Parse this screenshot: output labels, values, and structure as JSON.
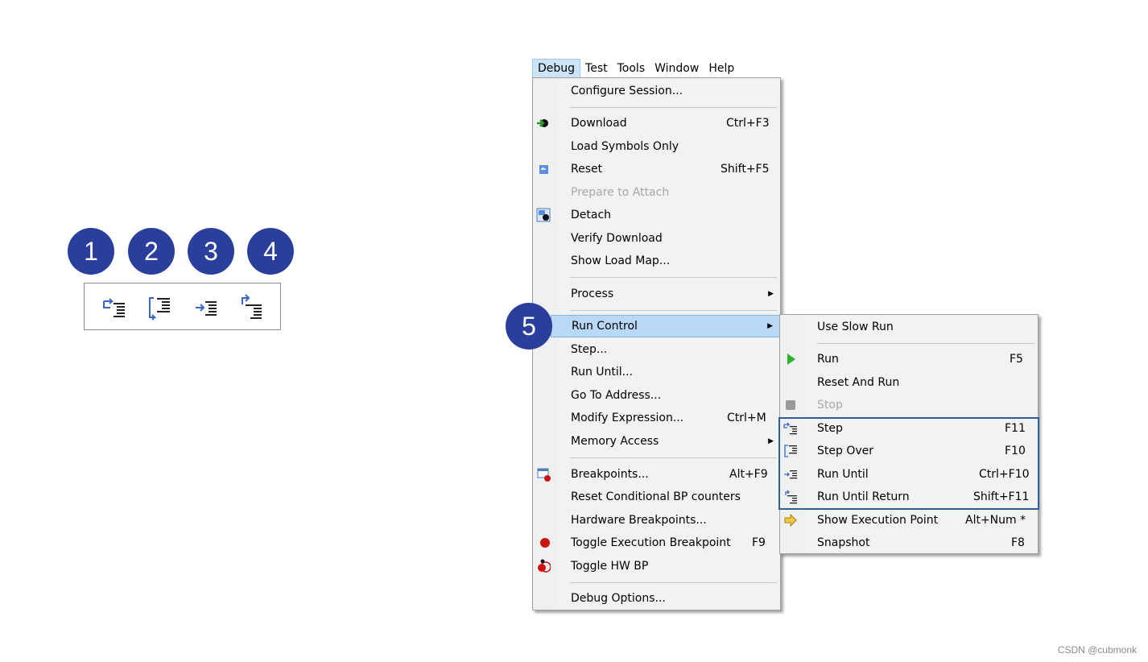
{
  "badges": [
    "1",
    "2",
    "3",
    "4",
    "5"
  ],
  "toolbar": {
    "buttons": [
      {
        "name": "step",
        "icon": "step-into-icon"
      },
      {
        "name": "step-over",
        "icon": "step-over-icon"
      },
      {
        "name": "run-until",
        "icon": "run-until-icon"
      },
      {
        "name": "run-until-return",
        "icon": "run-until-return-icon"
      }
    ]
  },
  "menubar": [
    "Debug",
    "Test",
    "Tools",
    "Window",
    "Help"
  ],
  "debug_menu": {
    "items": [
      {
        "label": "Configure Session...",
        "shortcut": ""
      },
      {
        "label": "Download",
        "shortcut": "Ctrl+F3",
        "icon": "download-icon"
      },
      {
        "label": "Load Symbols Only",
        "shortcut": ""
      },
      {
        "label": "Reset",
        "shortcut": "Shift+F5",
        "icon": "reset-icon"
      },
      {
        "label": "Prepare to Attach",
        "shortcut": "",
        "disabled": true
      },
      {
        "label": "Detach",
        "shortcut": "",
        "icon": "detach-icon"
      },
      {
        "label": "Verify Download",
        "shortcut": ""
      },
      {
        "label": "Show Load Map...",
        "shortcut": ""
      },
      {
        "label": "Process",
        "shortcut": "",
        "submenu": true
      },
      {
        "label": "Run Control",
        "shortcut": "",
        "submenu": true,
        "highlighted": true
      },
      {
        "label": "Step...",
        "shortcut": ""
      },
      {
        "label": "Run Until...",
        "shortcut": ""
      },
      {
        "label": "Go To Address...",
        "shortcut": ""
      },
      {
        "label": "Modify Expression...",
        "shortcut": "Ctrl+M"
      },
      {
        "label": "Memory Access",
        "shortcut": "",
        "submenu": true
      },
      {
        "label": "Breakpoints...",
        "shortcut": "Alt+F9",
        "icon": "breakpoints-icon"
      },
      {
        "label": "Reset Conditional BP counters",
        "shortcut": ""
      },
      {
        "label": "Hardware Breakpoints...",
        "shortcut": ""
      },
      {
        "label": "Toggle Execution Breakpoint",
        "shortcut": "F9",
        "icon": "breakpoint-dot-icon"
      },
      {
        "label": "Toggle HW BP",
        "shortcut": "",
        "icon": "hw-breakpoint-icon"
      },
      {
        "label": "Debug Options...",
        "shortcut": ""
      }
    ]
  },
  "run_control_menu": {
    "items": [
      {
        "label": "Use Slow Run",
        "shortcut": ""
      },
      {
        "label": "Run",
        "shortcut": "F5",
        "icon": "run-play-icon"
      },
      {
        "label": "Reset And Run",
        "shortcut": ""
      },
      {
        "label": "Stop",
        "shortcut": "",
        "disabled": true,
        "icon": "stop-icon"
      },
      {
        "label": "Step",
        "shortcut": "F11",
        "icon": "step-into-icon"
      },
      {
        "label": "Step Over",
        "shortcut": "F10",
        "icon": "step-over-icon"
      },
      {
        "label": "Run Until",
        "shortcut": "Ctrl+F10",
        "icon": "run-until-icon"
      },
      {
        "label": "Run Until Return",
        "shortcut": "Shift+F11",
        "icon": "run-until-return-icon"
      },
      {
        "label": "Show Execution Point",
        "shortcut": "Alt+Num *",
        "icon": "execution-point-arrow-icon"
      },
      {
        "label": "Snapshot",
        "shortcut": "F8"
      }
    ]
  },
  "watermark": "CSDN @cubmonk",
  "colors": {
    "badge": "#2a3f9c",
    "highlight": "#b9d8f5",
    "box": "#2f5e9e"
  }
}
